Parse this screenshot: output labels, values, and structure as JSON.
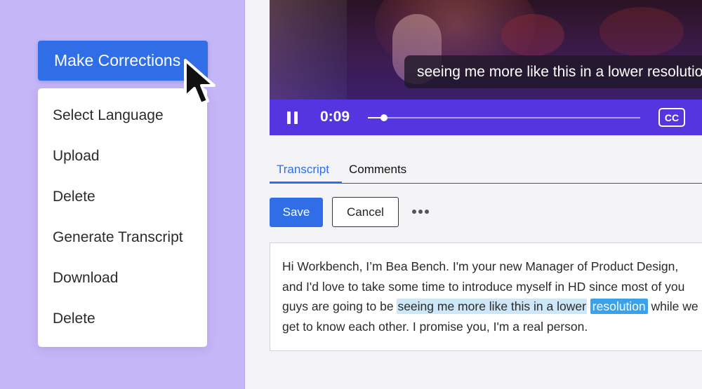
{
  "colors": {
    "accent": "#2f6ee6",
    "left_panel_bg": "#c5b6f7",
    "player_controls": "#5436e0",
    "highlight": "#cde7f8",
    "highlight_strong": "#3aa2ea"
  },
  "primary_button": {
    "label": "Make Corrections"
  },
  "menu": {
    "items": [
      "Select Language",
      "Upload",
      "Delete",
      "Generate Transcript",
      "Download",
      "Delete"
    ]
  },
  "video": {
    "caption": "seeing me more like this in a lower resolution",
    "time": "0:09",
    "progress_fraction": 0.06,
    "cc_label": "CC",
    "pause_icon": "pause-icon"
  },
  "tabs": [
    {
      "label": "Transcript",
      "active": true
    },
    {
      "label": "Comments",
      "active": false
    }
  ],
  "toolbar": {
    "save_label": "Save",
    "cancel_label": "Cancel",
    "more_icon": "more-horizontal-icon"
  },
  "transcript": {
    "before": "Hi Workbench, I’m Bea Bench. I'm your new Manager of Product Design, and I'd love to take some time to introduce myself in HD since most of you guys are going to be ",
    "highlight": "seeing me more like this in a lower",
    "selected": "resolution",
    "after": " while we get to know each other. I promise you, I'm a real person."
  }
}
